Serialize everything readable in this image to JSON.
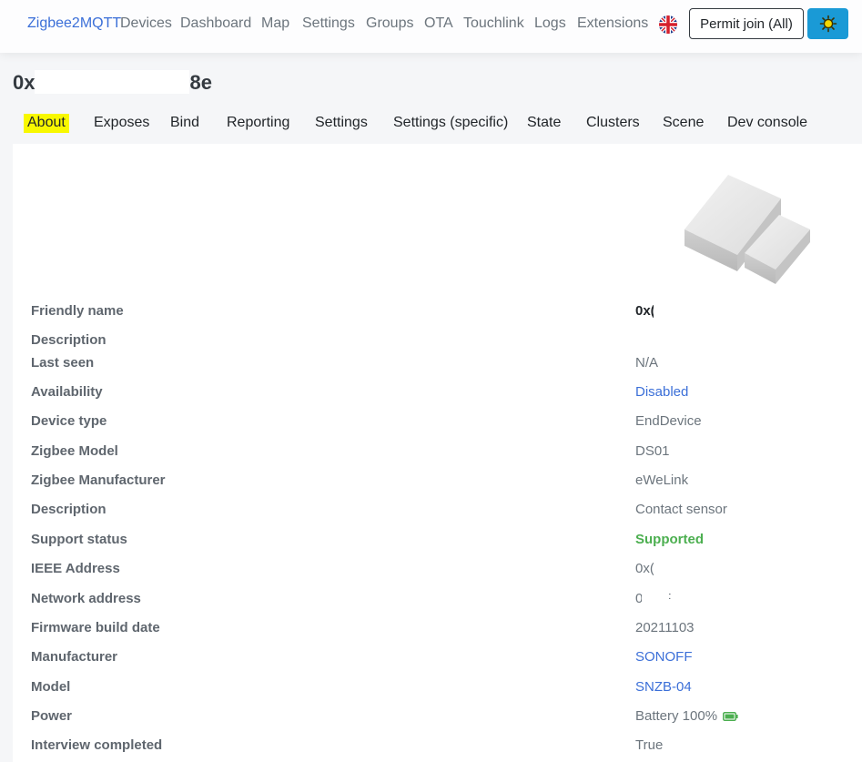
{
  "navbar": {
    "brand": "Zigbee2MQTT",
    "links": [
      "Devices",
      "Dashboard",
      "Map",
      "Settings",
      "Groups",
      "OTA",
      "Touchlink",
      "Logs",
      "Extensions"
    ],
    "language_icon": "uk-flag-icon",
    "permit_join_label": "Permit join (All)",
    "theme_icon": "sun-icon"
  },
  "device": {
    "title_start": "0x",
    "title_end": "8e"
  },
  "tabs": [
    "About",
    "Exposes",
    "Bind",
    "Reporting",
    "Settings",
    "Settings (specific)",
    "State",
    "Clusters",
    "Scene",
    "Dev console"
  ],
  "active_tab": "About",
  "about": {
    "rows": [
      {
        "label": "Friendly name",
        "value": "0x(        8e"
      },
      {
        "label": "Description",
        "value": ""
      },
      {
        "label": "Last seen",
        "value": "N/A"
      },
      {
        "label": "Availability",
        "value": "Disabled"
      },
      {
        "label": "Device type",
        "value": "EndDevice"
      },
      {
        "label": "Zigbee Model",
        "value": "DS01"
      },
      {
        "label": "Zigbee Manufacturer",
        "value": "eWeLink"
      },
      {
        "label": "Description",
        "value": "Contact sensor"
      },
      {
        "label": "Support status",
        "value": "Supported"
      },
      {
        "label": "IEEE Address",
        "value": "0x(        8e"
      },
      {
        "label": "Network address",
        "value": "0    )F"
      },
      {
        "label": "Firmware build date",
        "value": "20211103"
      },
      {
        "label": "Manufacturer",
        "value": "SONOFF"
      },
      {
        "label": "Model",
        "value": "SNZB-04"
      },
      {
        "label": "Power",
        "value": "Battery 100%"
      },
      {
        "label": "Interview completed",
        "value": "True"
      }
    ],
    "battery_icon": "battery-full-icon",
    "device_image": "contact-sensor-image"
  },
  "colors": {
    "link": "#3b6fd8",
    "supported": "#4caf50",
    "tab_highlight": "#f8f800",
    "theme_button": "#1a9ad6"
  }
}
